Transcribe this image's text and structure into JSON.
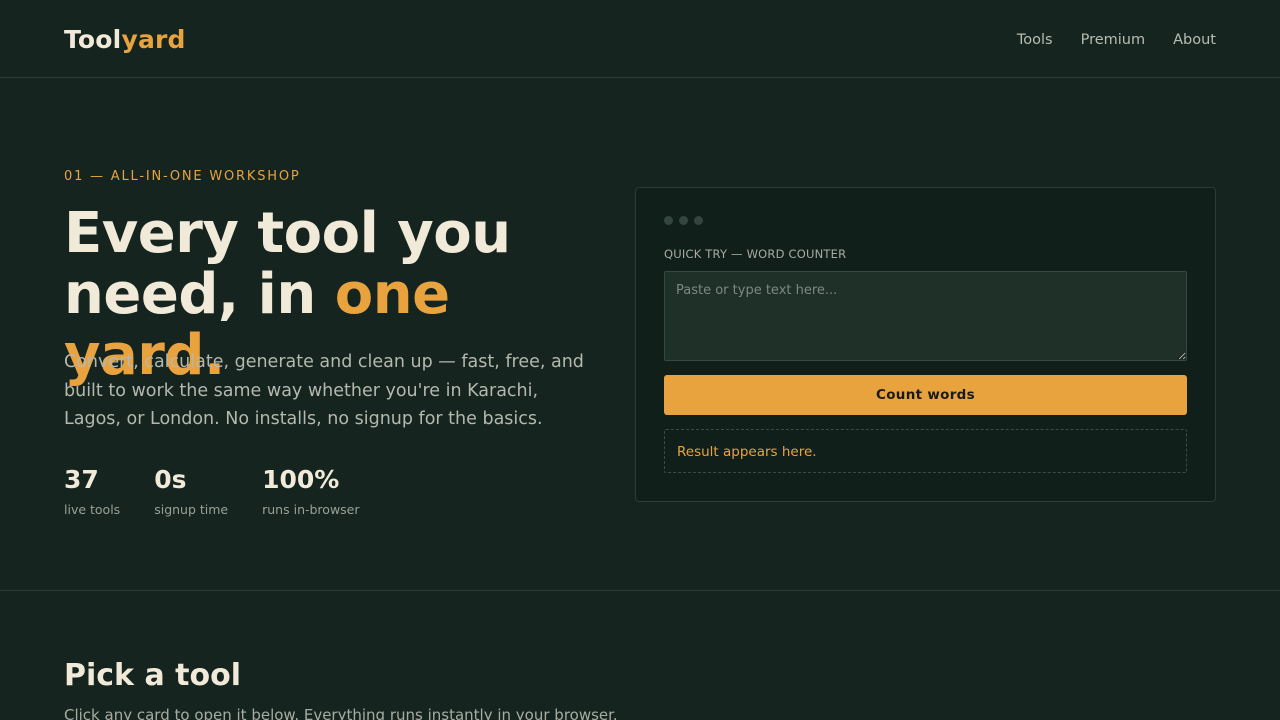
{
  "header": {
    "logo_part1": "Tool",
    "logo_part2": "yard",
    "nav": [
      "Tools",
      "Premium",
      "About"
    ]
  },
  "hero": {
    "eyebrow": "01 — ALL-IN-ONE WORKSHOP",
    "headline_line1": "Every tool you",
    "headline_line2_start": "need, in ",
    "headline_accent": "one yard.",
    "lead": "Convert, calculate, generate and clean up — fast, free, and built to work the same way whether you're in Karachi, Lagos, or London. No installs, no signup for the basics.",
    "stats": [
      {
        "value": "37",
        "label": "live tools"
      },
      {
        "value": "0s",
        "label": "signup time"
      },
      {
        "value": "100%",
        "label": "runs in-browser"
      }
    ]
  },
  "quick_try": {
    "label": "QUICK TRY — WORD COUNTER",
    "placeholder": "Paste or type text here...",
    "button_label": "Count words",
    "result_text": "Result appears here."
  },
  "tools_section": {
    "title": "Pick a tool",
    "subtitle": "Click any card to open it below. Everything runs instantly in your browser."
  },
  "colors": {
    "background": "#15241f",
    "accent": "#e8a33e",
    "text": "#f2ead9"
  }
}
